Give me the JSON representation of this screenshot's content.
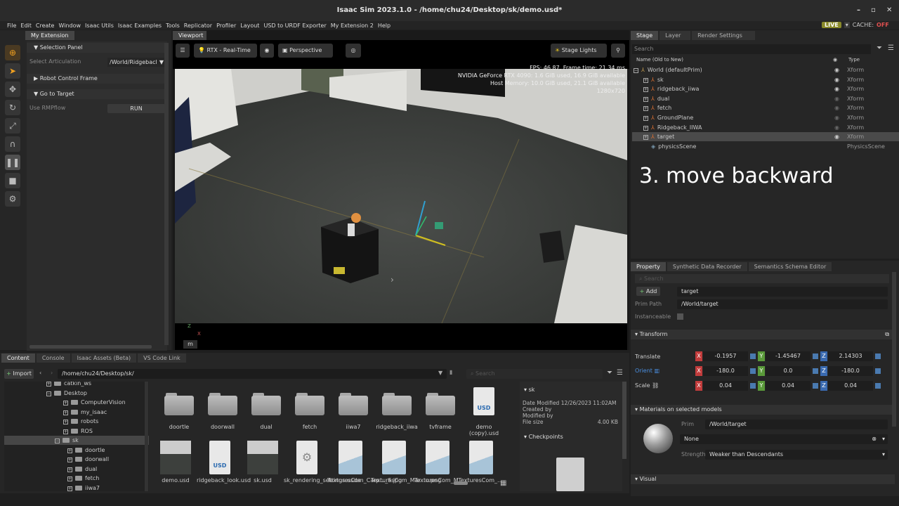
{
  "window": {
    "title": "Isaac Sim 2023.1.0 - /home/chu24/Desktop/sk/demo.usd*",
    "minimize": "–",
    "maximize": "▫",
    "close": "✕"
  },
  "menu": [
    "File",
    "Edit",
    "Create",
    "Window",
    "Isaac Utils",
    "Isaac Examples",
    "Tools",
    "Replicator",
    "Profiler",
    "Layout",
    "USD to URDF Exporter",
    "My Extension 2",
    "Help"
  ],
  "live": {
    "label": "LIVE",
    "cache": "CACHE:",
    "cache_state": "OFF"
  },
  "left": {
    "tab": "My Extension 2",
    "selection_panel": "Selection Panel",
    "select_articulation_label": "Select Articulation",
    "select_articulation_value": "/World/Ridgebacl",
    "robot_control_frame": "Robot Control Frame",
    "go_to_target": "Go to Target",
    "use_rmpflow": "Use RMPflow",
    "run": "RUN"
  },
  "viewport": {
    "tab": "Viewport",
    "renderer": "RTX - Real-Time",
    "camera": "Perspective",
    "lights": "Stage Lights",
    "stats": [
      "FPS: 46.87, Frame time: 21.34 ms",
      "NVIDIA GeForce RTX 4090: 1.6 GiB used, 16.9 GiB available",
      "Host Memory: 10.0 GiB used, 21.1 GiB available",
      "1280x720"
    ],
    "unit": "m",
    "axis_z": "Z",
    "axis_x": "X"
  },
  "stage": {
    "tabs": [
      "Stage",
      "Layer",
      "Render Settings"
    ],
    "search_placeholder": "Search",
    "col_name": "Name (Old to New)",
    "col_type": "Type",
    "items": [
      {
        "name": "World (defaultPrim)",
        "type": "Xform"
      },
      {
        "name": "sk",
        "type": "Xform"
      },
      {
        "name": "ridgeback_iiwa",
        "type": "Xform"
      },
      {
        "name": "dual",
        "type": "Xform"
      },
      {
        "name": "fetch",
        "type": "Xform"
      },
      {
        "name": "GroundPlane",
        "type": "Xform"
      },
      {
        "name": "Ridgeback_IIWA",
        "type": "Xform"
      },
      {
        "name": "target",
        "type": "Xform"
      },
      {
        "name": "physicsScene",
        "type": "PhysicsScene"
      }
    ]
  },
  "caption": "3. move backward",
  "property": {
    "tabs": [
      "Property",
      "Synthetic Data Recorder",
      "Semantics Schema Editor"
    ],
    "search_placeholder": "Search",
    "add": "Add",
    "name_value": "target",
    "prim_path_label": "Prim Path",
    "prim_path_value": "/World/target",
    "instanceable": "Instanceable",
    "transform": "Transform",
    "translate": "Translate",
    "orient": "Orient",
    "scale": "Scale",
    "translate_vals": [
      "-0.1957",
      "-1.45467",
      "2.14303"
    ],
    "orient_vals": [
      "-180.0",
      "0.0",
      "-180.0"
    ],
    "scale_vals": [
      "0.04",
      "0.04",
      "0.04"
    ],
    "axes": [
      "X",
      "Y",
      "Z"
    ],
    "materials": "Materials on selected models",
    "prim_label": "Prim",
    "prim_value": "/World/target",
    "material_value": "None",
    "strength_label": "Strength",
    "strength_value": "Weaker than Descendants",
    "visual": "Visual"
  },
  "content": {
    "tabs": [
      "Content",
      "Console",
      "Isaac Assets (Beta)",
      "VS Code Link"
    ],
    "import": "Import",
    "path": "/home/chu24/Desktop/sk/",
    "search_placeholder": "Search",
    "tree": [
      "catkin_ws",
      "Desktop",
      "ComputerVision",
      "my_isaac",
      "robots",
      "ROS",
      "sk",
      "doortle",
      "doorwall",
      "dual",
      "fetch",
      "iiwa7"
    ],
    "folders": [
      "doortle",
      "doorwall",
      "dual",
      "fetch",
      "iiwa7",
      "ridgeback_iiwa",
      "tvframe"
    ],
    "usd_file": "demo (copy).usd",
    "files2": [
      "demo.usd",
      "ridgeback_look.usd",
      "sk.usd",
      "sk_rendering_settings.usda",
      "TexturesCom_Carp..._S.jpg",
      "TexturesCom_Mar...o.png",
      "TexturesCom_M...",
      "TexturesCom_..."
    ],
    "detail_title": "sk",
    "detail": [
      "Date Modified 12/26/2023 11:02AM",
      "Created by",
      "Modified by",
      "File size"
    ],
    "file_size": "4.00 KB",
    "checkpoints": "Checkpoints"
  }
}
